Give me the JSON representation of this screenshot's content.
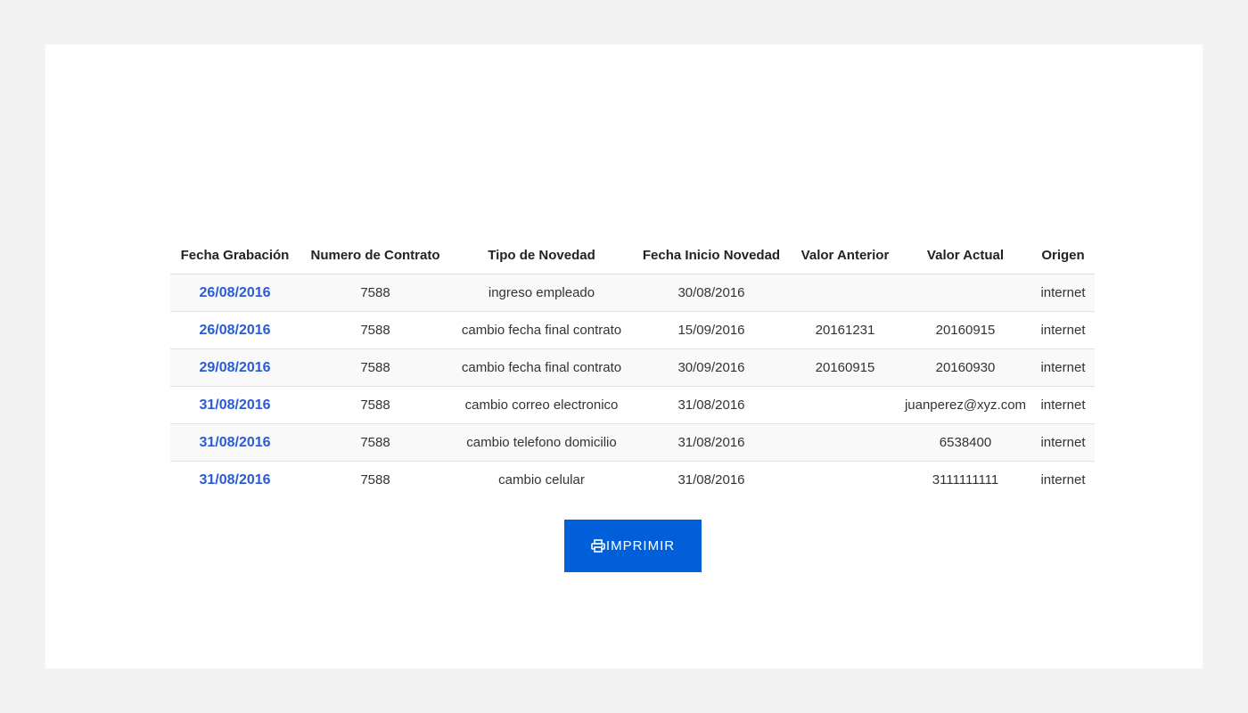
{
  "table": {
    "headers": [
      "Fecha Grabación",
      "Numero de Contrato",
      "Tipo de Novedad",
      "Fecha Inicio Novedad",
      "Valor Anterior",
      "Valor Actual",
      "Origen"
    ],
    "rows": [
      [
        "26/08/2016",
        "7588",
        "ingreso empleado",
        "30/08/2016",
        "",
        "",
        "internet"
      ],
      [
        "26/08/2016",
        "7588",
        "cambio fecha final contrato",
        "15/09/2016",
        "20161231",
        "20160915",
        "internet"
      ],
      [
        "29/08/2016",
        "7588",
        "cambio fecha final contrato",
        "30/09/2016",
        "20160915",
        "20160930",
        "internet"
      ],
      [
        "31/08/2016",
        "7588",
        "cambio correo electronico",
        "31/08/2016",
        "",
        "juanperez@xyz.com",
        "internet"
      ],
      [
        "31/08/2016",
        "7588",
        "cambio telefono domicilio",
        "31/08/2016",
        "",
        "6538400",
        "internet"
      ],
      [
        "31/08/2016",
        "7588",
        "cambio celular",
        "31/08/2016",
        "",
        "3111111111",
        "internet"
      ]
    ]
  },
  "print_button": {
    "label": "IMPRIMIR",
    "icon": "printer-icon",
    "color": "#005fd9"
  },
  "colors": {
    "link": "#2a5bd7",
    "page_background": "#f2f2f2",
    "card_background": "#ffffff"
  }
}
